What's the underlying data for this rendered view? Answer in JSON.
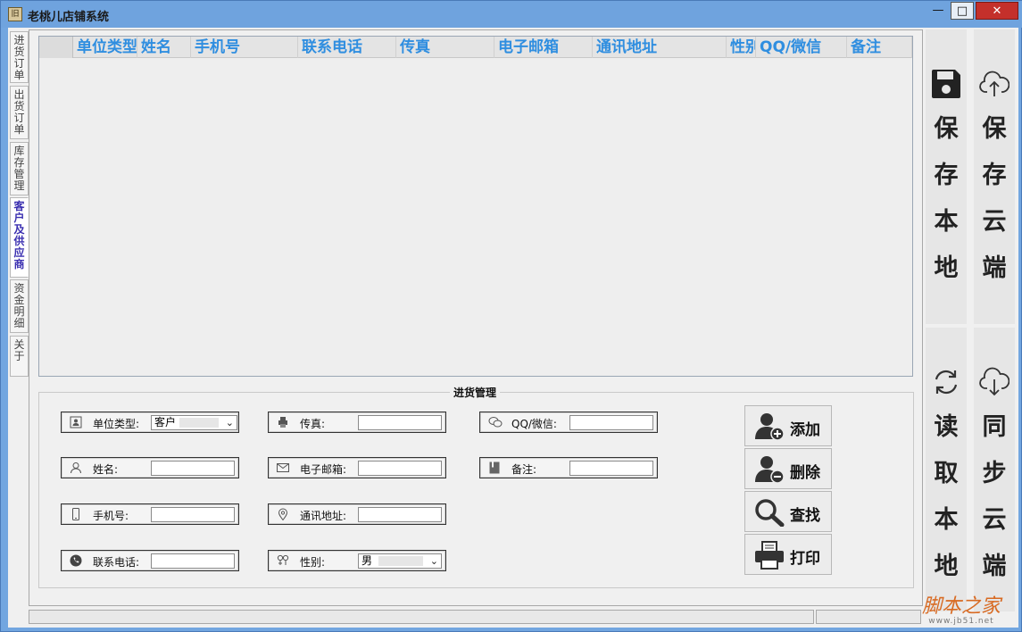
{
  "window": {
    "title": "老桃儿店铺系统",
    "icon_text": "旧",
    "controls": {
      "minimize": "—",
      "maximize": "□",
      "close": "✕"
    }
  },
  "tabs": [
    {
      "label": "进货订单",
      "active": false
    },
    {
      "label": "出货订单",
      "active": false
    },
    {
      "label": "库存管理",
      "active": false
    },
    {
      "label": "客户及供应商",
      "active": true
    },
    {
      "label": "资金明细",
      "active": false
    },
    {
      "label": "关于",
      "active": false
    }
  ],
  "grid": {
    "columns": [
      "单位类型",
      "姓名",
      "手机号",
      "联系电话",
      "传真",
      "电子邮箱",
      "通讯地址",
      "性别",
      "QQ/微信",
      "备注"
    ],
    "rows": []
  },
  "form": {
    "group_title": "进货管理",
    "unit_type": {
      "label": "单位类型:",
      "value": "客户",
      "icon": "id-card-icon"
    },
    "name": {
      "label": "姓名:",
      "value": "",
      "icon": "person-icon"
    },
    "mobile": {
      "label": "手机号:",
      "value": "",
      "icon": "mobile-phone-icon"
    },
    "phone": {
      "label": "联系电话:",
      "value": "",
      "icon": "phone-icon"
    },
    "fax": {
      "label": "传真:",
      "value": "",
      "icon": "fax-icon"
    },
    "email": {
      "label": "电子邮箱:",
      "value": "",
      "icon": "envelope-icon"
    },
    "address": {
      "label": "通讯地址:",
      "value": "",
      "icon": "location-pin-icon"
    },
    "gender": {
      "label": "性别:",
      "value": "男",
      "icon": "gender-icon"
    },
    "qq_wechat": {
      "label": "QQ/微信:",
      "value": "",
      "icon": "wechat-icon"
    },
    "note": {
      "label": "备注:",
      "value": "",
      "icon": "notebook-icon"
    }
  },
  "actions": {
    "add": "添加",
    "delete": "删除",
    "search": "查找",
    "print": "打印"
  },
  "right_panel": {
    "save_local": [
      "保",
      "存",
      "本",
      "地"
    ],
    "save_cloud": [
      "保",
      "存",
      "云",
      "端"
    ],
    "read_local": [
      "读",
      "取",
      "本",
      "地"
    ],
    "sync_cloud": [
      "同",
      "步",
      "云",
      "端"
    ]
  },
  "watermark": {
    "main": "脚本之家",
    "sub": "www.jb51.net"
  },
  "colors": {
    "header_text": "#2f8ee0",
    "active_tab": "#3a2fb0",
    "close_button": "#c4302b"
  }
}
